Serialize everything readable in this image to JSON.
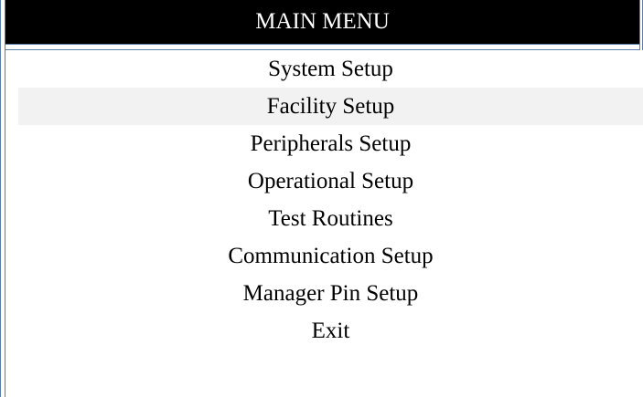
{
  "menu": {
    "title": "MAIN MENU",
    "selected_index": 1,
    "items": [
      {
        "label": "System Setup"
      },
      {
        "label": "Facility Setup"
      },
      {
        "label": "Peripherals Setup"
      },
      {
        "label": "Operational Setup"
      },
      {
        "label": "Test Routines"
      },
      {
        "label": "Communication Setup"
      },
      {
        "label": "Manager Pin Setup"
      },
      {
        "label": "Exit"
      }
    ]
  },
  "colors": {
    "title_bg": "#000000",
    "title_fg": "#ffffff",
    "border": "#5b7fa8",
    "selected_bg": "#f2f2f2"
  }
}
